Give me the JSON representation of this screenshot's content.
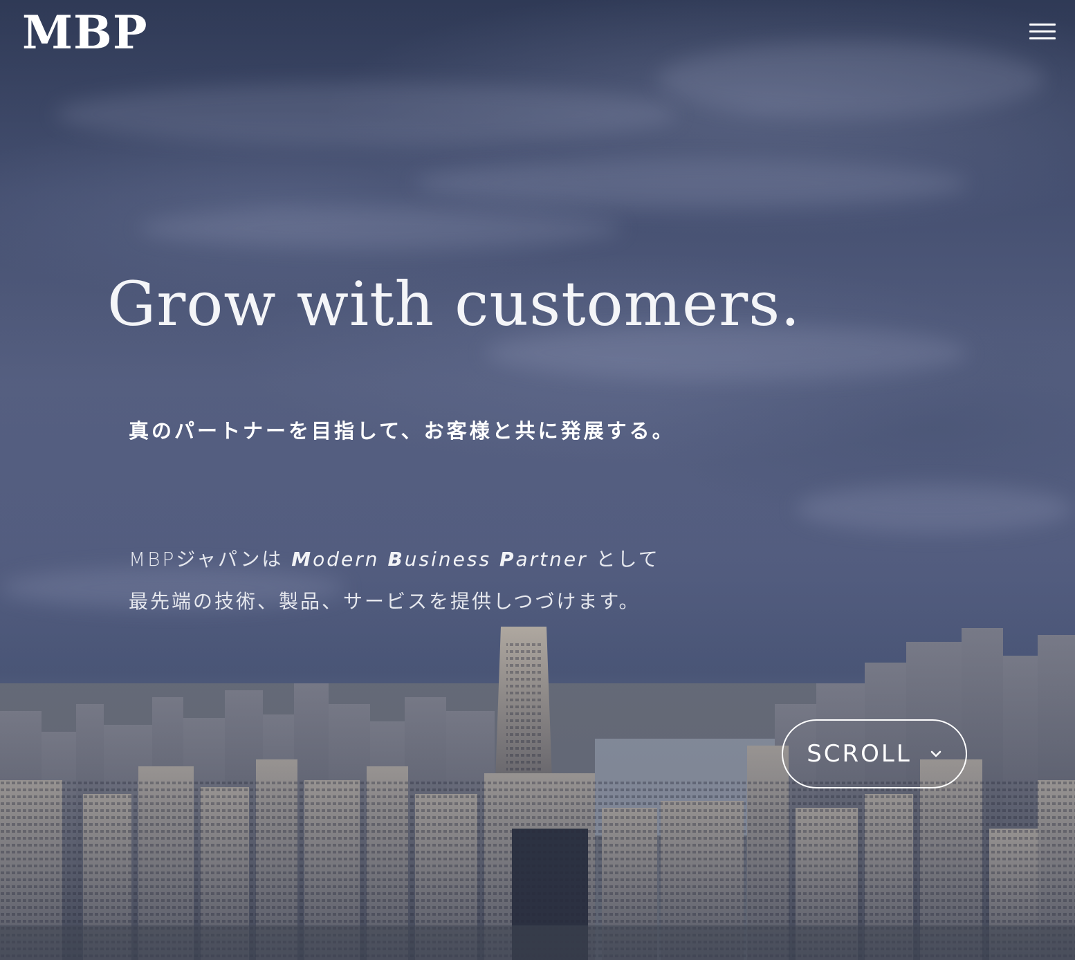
{
  "header": {
    "logo_text": "MBP",
    "menu_icon": "hamburger-menu-icon"
  },
  "hero": {
    "headline": "Grow with customers.",
    "tagline": "真のパートナーを目指して、お客様と共に発展する。",
    "description": {
      "line1_prefix": "MBPジャパンは ",
      "modern_initial": "M",
      "modern_rest": "odern ",
      "business_initial": "B",
      "business_rest": "usiness ",
      "partner_initial": "P",
      "partner_rest": "artner",
      "line1_suffix": " として",
      "line2": "最先端の技術、製品、サービスを提供しつづけます。"
    },
    "scroll_button": {
      "label": "SCROLL",
      "icon": "chevron-down-icon"
    }
  },
  "colors": {
    "overlay": "#3b4664",
    "text": "#ffffff"
  }
}
